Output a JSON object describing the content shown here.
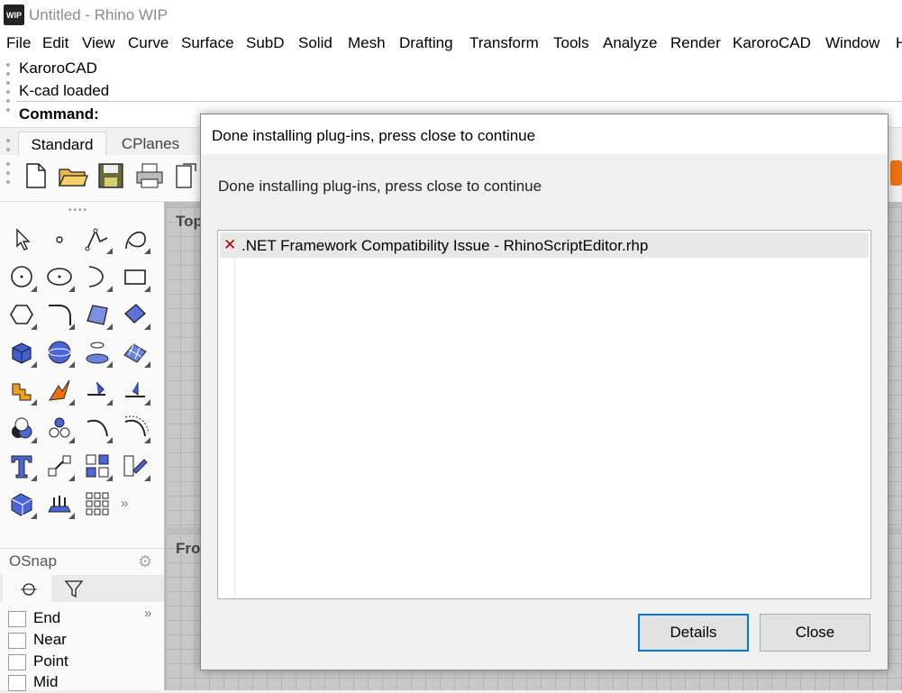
{
  "window": {
    "title": "Untitled - Rhino WIP",
    "icon": "rhino-logo-icon"
  },
  "menu": [
    "File",
    "Edit",
    "View",
    "Curve",
    "Surface",
    "SubD",
    "Solid",
    "Mesh",
    "Drafting",
    "Transform",
    "Tools",
    "Analyze",
    "Render",
    "KaroroCAD",
    "Window",
    "H"
  ],
  "command_history": [
    "KaroroCAD",
    "K-cad loaded"
  ],
  "command_prompt": "Command:",
  "toolbar_tabs": [
    "Standard",
    "CPlanes"
  ],
  "standard_tools": [
    "new-file-icon",
    "open-folder-icon",
    "save-icon",
    "print-icon",
    "copy-icon"
  ],
  "sidebar_tools": [
    "select-icon",
    "point-icon",
    "polyline-icon",
    "curve-icon",
    "circle-icon",
    "ellipse-icon",
    "arc-icon",
    "rectangle-icon",
    "polygon-icon",
    "fillet-icon",
    "surface-from-points-icon",
    "extrude-surface-icon",
    "box-icon",
    "sphere-icon",
    "cylinder-icon",
    "mesh-icon",
    "boolean-icon",
    "explode-icon",
    "trim-icon",
    "split-icon",
    "group-icon",
    "points-icon",
    "offset-icon",
    "curve-offset-icon",
    "text-icon",
    "move-icon",
    "array-icon",
    "transform-icon",
    "solid-tools-icon",
    "extrude-icon",
    "grid-array-icon"
  ],
  "more_label": "»",
  "viewports": {
    "top": "Top",
    "front": "Fro"
  },
  "osnap": {
    "title": "OSnap",
    "more": "»",
    "items": [
      {
        "label": "End",
        "checked": false
      },
      {
        "label": "Near",
        "checked": false
      },
      {
        "label": "Point",
        "checked": false
      },
      {
        "label": "Mid",
        "checked": false
      }
    ]
  },
  "dialog": {
    "title": "Done installing plug-ins, press close to continue",
    "message": "Done installing plug-ins, press close to continue",
    "items": [
      {
        "status": "error",
        "text": ".NET Framework Compatibility Issue - RhinoScriptEditor.rhp"
      }
    ],
    "details_label": "Details",
    "close_label": "Close"
  },
  "colors": {
    "error": "#b00000",
    "accent": "#0078d7"
  }
}
